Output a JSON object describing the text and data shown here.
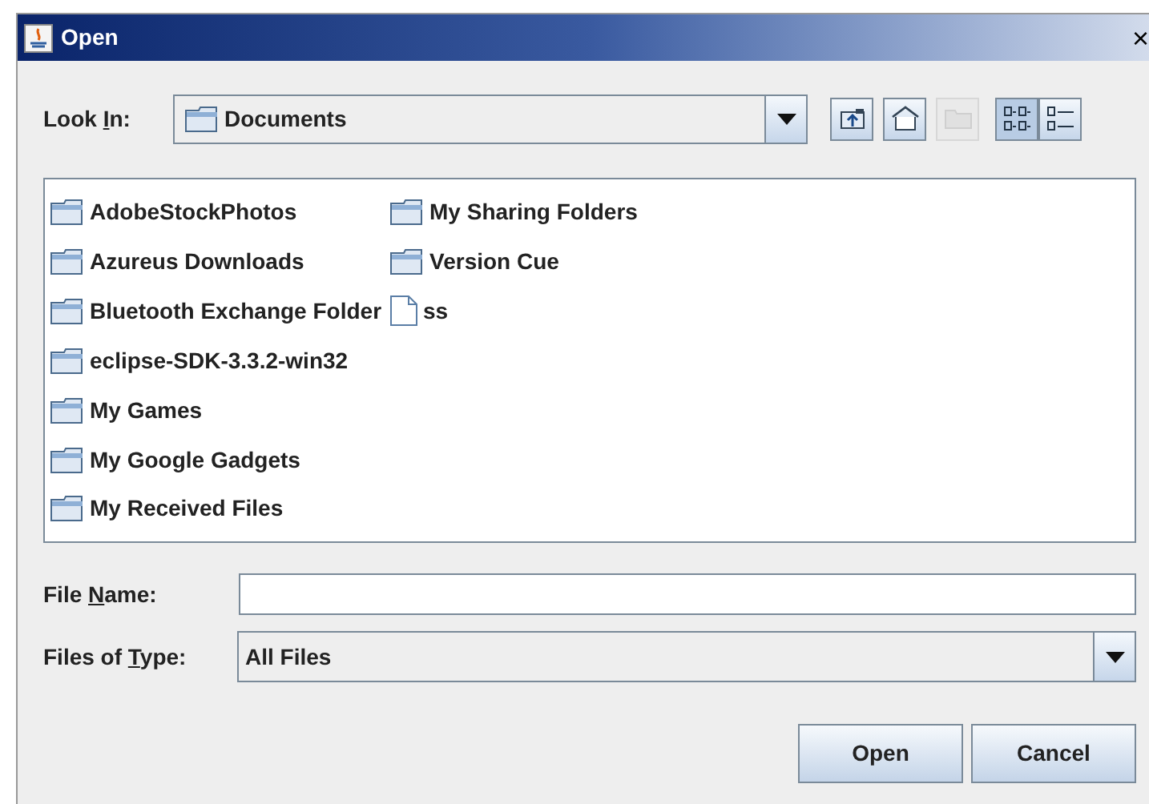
{
  "window": {
    "title": "Open",
    "close": "×"
  },
  "look_in": {
    "label": {
      "before": "Look ",
      "key": "I",
      "after": "n:"
    },
    "value": "Documents"
  },
  "toolbar": [
    {
      "kind": "up",
      "disabled": false,
      "selected": false
    },
    {
      "kind": "home",
      "disabled": false,
      "selected": false
    },
    {
      "kind": "new-folder",
      "disabled": true,
      "selected": false
    },
    {
      "kind": "list",
      "disabled": false,
      "selected": true
    },
    {
      "kind": "details",
      "disabled": false,
      "selected": false
    }
  ],
  "files": [
    {
      "name": "AdobeStockPhotos",
      "kind": "folder"
    },
    {
      "name": "Azureus Downloads",
      "kind": "folder"
    },
    {
      "name": "Bluetooth Exchange Folder",
      "kind": "folder"
    },
    {
      "name": "eclipse-SDK-3.3.2-win32",
      "kind": "folder"
    },
    {
      "name": "My Games",
      "kind": "folder"
    },
    {
      "name": "My Google Gadgets",
      "kind": "folder"
    },
    {
      "name": "My Received Files",
      "kind": "folder"
    },
    {
      "name": "My Sharing Folders",
      "kind": "folder"
    },
    {
      "name": "Version Cue",
      "kind": "folder"
    },
    {
      "name": "ss",
      "kind": "file"
    }
  ],
  "file_name": {
    "label": {
      "before": "File ",
      "key": "N",
      "after": "ame:"
    }
  },
  "file_type": {
    "label": {
      "before": "Files of ",
      "key": "T",
      "after": "ype:"
    },
    "value": "All Files"
  },
  "buttons": [
    "Open",
    "Cancel"
  ]
}
